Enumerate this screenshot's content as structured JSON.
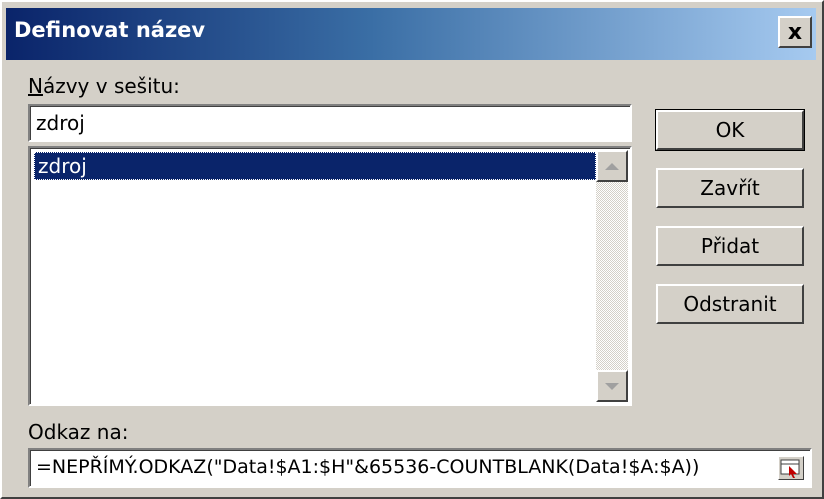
{
  "window": {
    "title": "Definovat název",
    "close_label": "x"
  },
  "names_label": "Názvy v sešitu:",
  "name_input": {
    "value": "zdroj"
  },
  "names_list": {
    "items": [
      {
        "label": "zdroj",
        "selected": true
      }
    ]
  },
  "buttons": {
    "ok": "OK",
    "close": "Zavřít",
    "add": "Přidat",
    "delete": "Odstranit"
  },
  "reference_label": "Odkaz na:",
  "reference_input": {
    "value": "=NEPŘÍMÝ.ODKAZ(\"Data!$A1:$H\"&65536-COUNTBLANK(Data!$A:$A))"
  },
  "colors": {
    "title_bar_start": "#0a246a",
    "title_bar_end": "#a6caf0",
    "dialog_background": "#d4d0c8",
    "selection": "#0a246a"
  },
  "icons": {
    "close": "close-icon",
    "scroll_up": "scroll-up-arrow-icon",
    "scroll_down": "scroll-down-arrow-icon",
    "range_picker": "range-picker-icon"
  }
}
